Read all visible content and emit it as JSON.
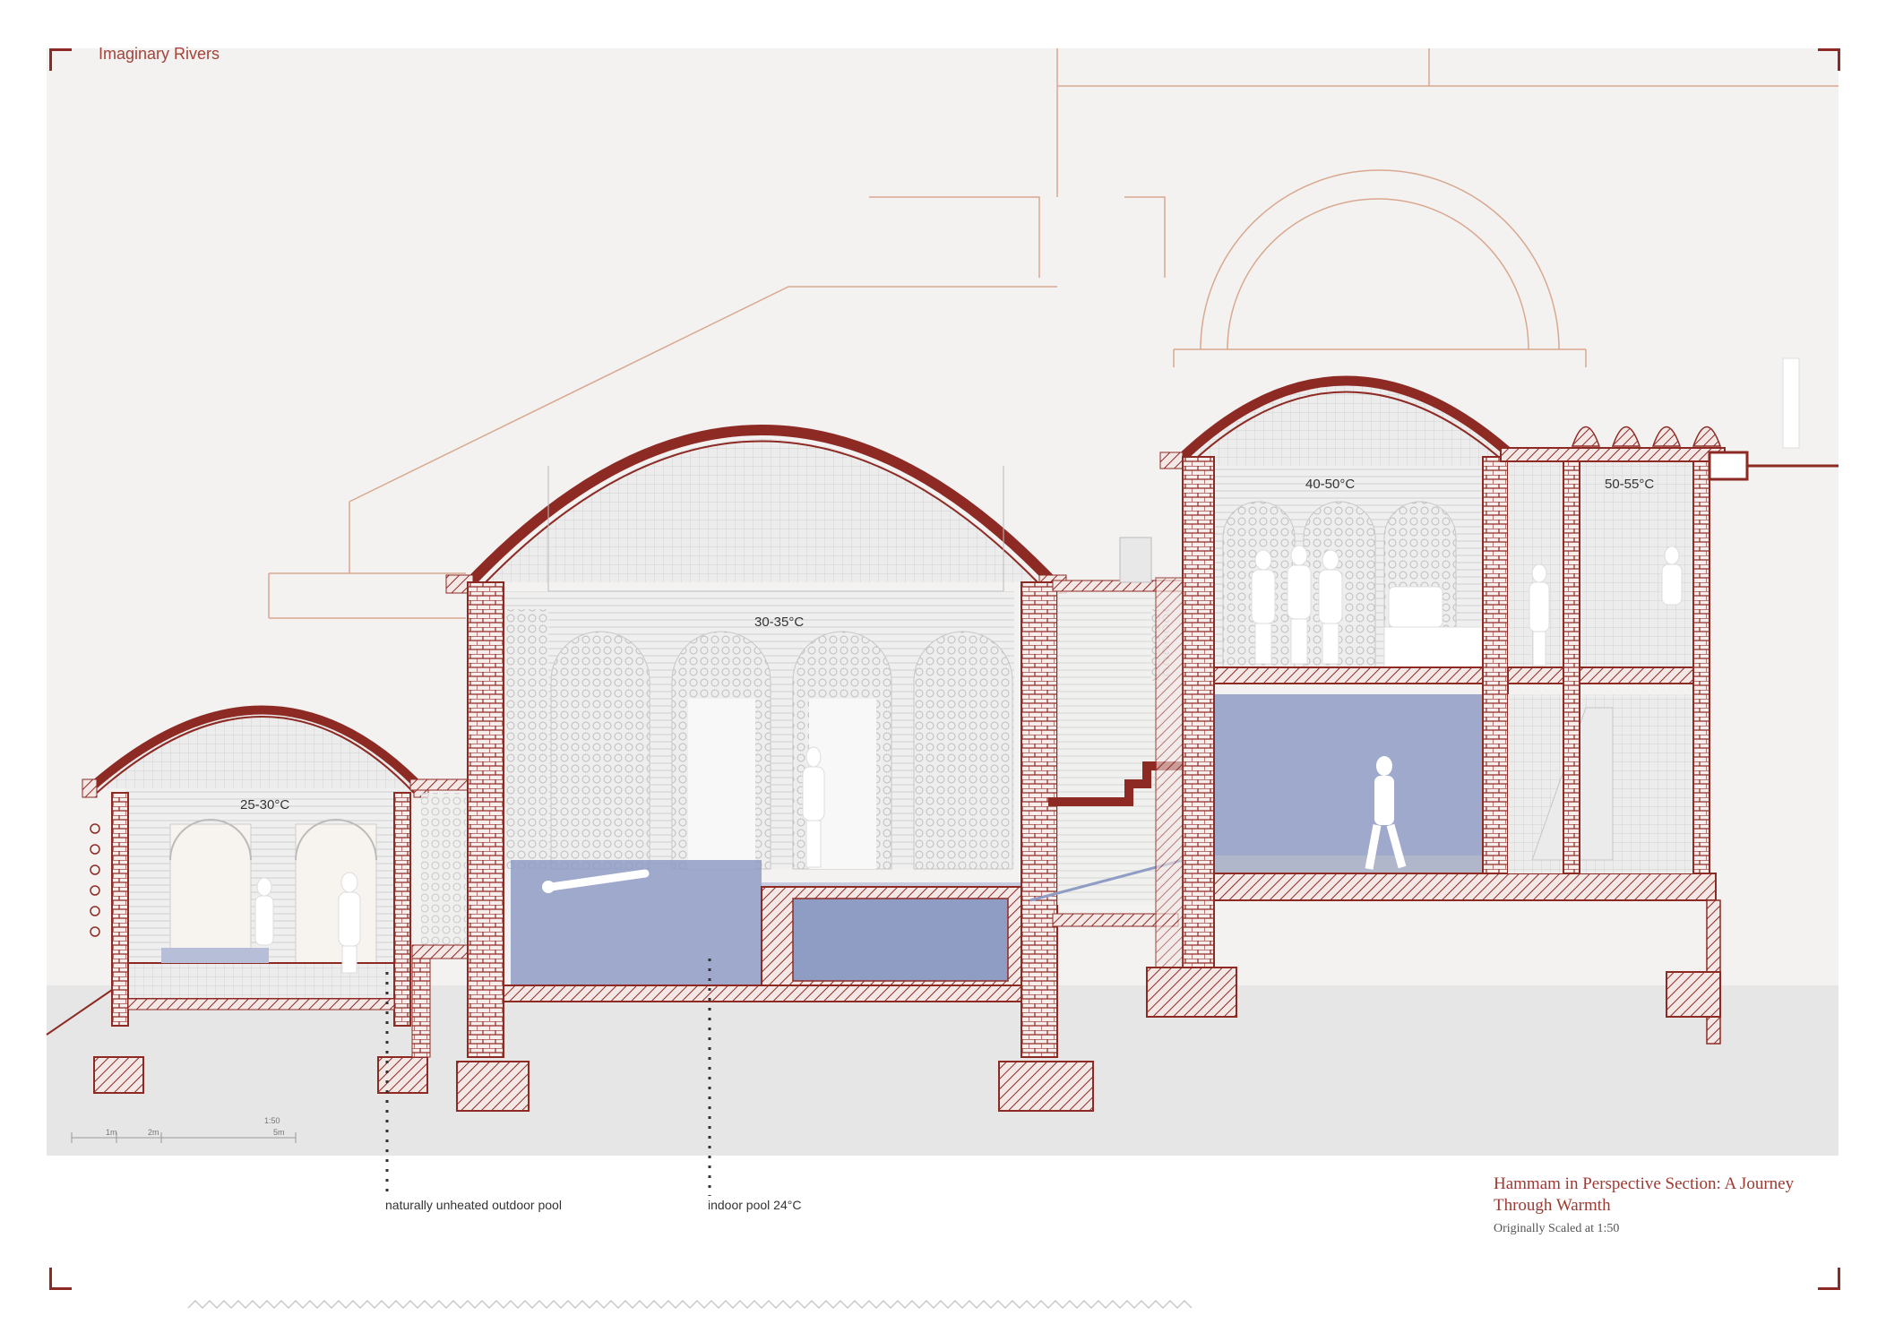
{
  "project_name": "Imaginary Rivers",
  "zones": [
    {
      "temperature": "25-30°C"
    },
    {
      "temperature": "30-35°C"
    },
    {
      "temperature": "40-50°C"
    },
    {
      "temperature": "50-55°C"
    }
  ],
  "annotations": {
    "outdoor_pool": "naturally unheated outdoor pool",
    "indoor_pool": "indoor pool 24°C"
  },
  "scale_bar": {
    "scale": "1:50",
    "ticks": [
      "1m",
      "2m",
      "5m"
    ]
  },
  "caption": {
    "title": "Hammam in Perspective Section: A Journey Through Warmth",
    "subtitle": "Originally Scaled at 1:50"
  },
  "colors": {
    "wall_red": "#8e2a24",
    "line_orange": "#d9a890",
    "water_blue": "#8f9cc4",
    "paper": "#f3f2f0"
  }
}
